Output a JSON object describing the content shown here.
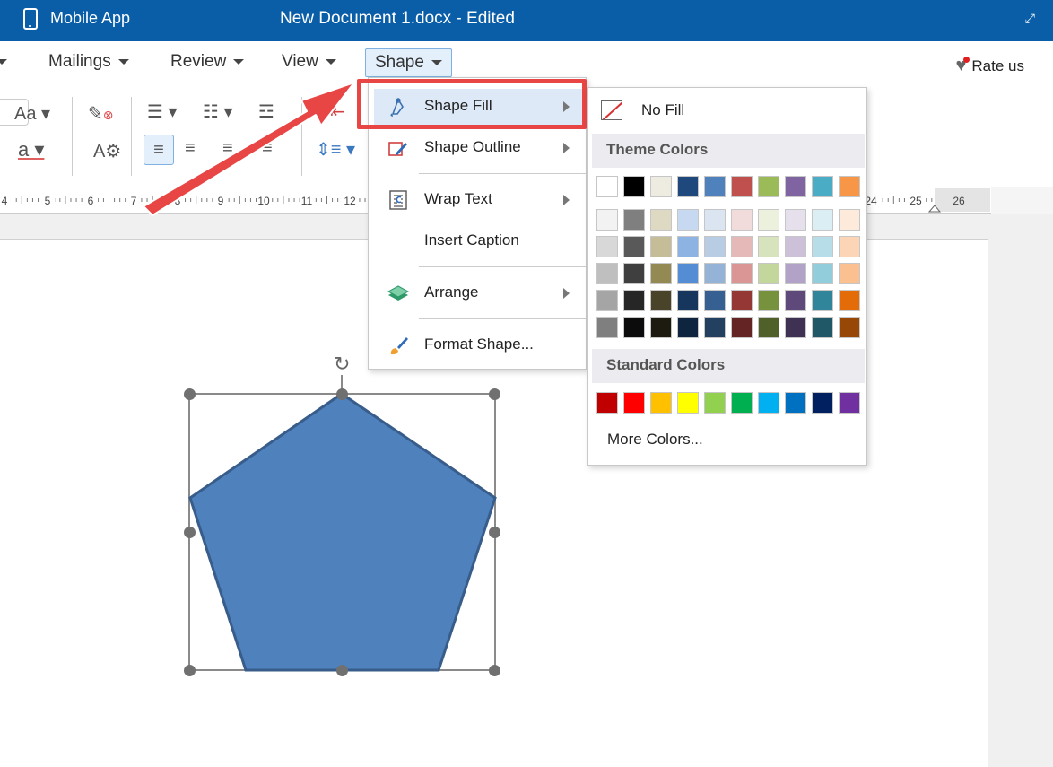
{
  "titlebar": {
    "app_name": "Mobile App",
    "doc_title": "New Document 1.docx - Edited"
  },
  "menubar": {
    "tabs": [
      {
        "label": "Mailings"
      },
      {
        "label": "Review"
      },
      {
        "label": "View"
      },
      {
        "label": "Shape",
        "active": true
      }
    ],
    "rate_label": "Rate us"
  },
  "ruler": {
    "labels": [
      "4",
      "5",
      "6",
      "7",
      "8",
      "9",
      "10",
      "11",
      "12",
      "24",
      "25",
      "26"
    ]
  },
  "shape_menu": {
    "items": [
      {
        "label": "Shape Fill",
        "icon": "paint-bucket-icon",
        "has_submenu": true
      },
      {
        "label": "Shape Outline",
        "icon": "pencil-outline-icon",
        "has_submenu": true
      },
      {
        "label": "Wrap Text",
        "icon": "wrap-text-icon",
        "has_submenu": true
      },
      {
        "label": "Insert Caption",
        "icon": "",
        "has_submenu": false
      },
      {
        "label": "Arrange",
        "icon": "layers-icon",
        "has_submenu": true
      },
      {
        "label": "Format Shape...",
        "icon": "paintbrush-icon",
        "has_submenu": false
      }
    ]
  },
  "color_menu": {
    "no_fill": "No Fill",
    "theme_header": "Theme Colors",
    "standard_header": "Standard Colors",
    "more_colors": "More Colors...",
    "theme_top": [
      "#ffffff",
      "#000000",
      "#eeece1",
      "#1f497d",
      "#4f81bd",
      "#c0504d",
      "#9bbb59",
      "#8064a2",
      "#4bacc6",
      "#f79646"
    ],
    "theme_shades": [
      [
        "#f2f2f2",
        "#7f7f7f",
        "#ddd9c3",
        "#c6d9f0",
        "#dbe5f1",
        "#f2dcdb",
        "#ebf1dd",
        "#e5e0ec",
        "#dbeef3",
        "#fdeada"
      ],
      [
        "#d8d8d8",
        "#595959",
        "#c4bd97",
        "#8db3e2",
        "#b8cce4",
        "#e5b9b7",
        "#d7e3bc",
        "#ccc1d9",
        "#b7dde8",
        "#fbd5b5"
      ],
      [
        "#bfbfbf",
        "#3f3f3f",
        "#938953",
        "#548dd4",
        "#95b3d7",
        "#d99694",
        "#c3d69b",
        "#b2a2c7",
        "#92cddc",
        "#fac08f"
      ],
      [
        "#a5a5a5",
        "#262626",
        "#494429",
        "#17365d",
        "#366092",
        "#953734",
        "#76923c",
        "#5f497a",
        "#31859b",
        "#e36c09"
      ],
      [
        "#7f7f7f",
        "#0c0c0c",
        "#1d1b10",
        "#0f243e",
        "#244061",
        "#632423",
        "#4f6128",
        "#3f3151",
        "#205867",
        "#974806"
      ]
    ],
    "standard": [
      "#c00000",
      "#ff0000",
      "#ffc000",
      "#ffff00",
      "#92d050",
      "#00b050",
      "#00b0f0",
      "#0070c0",
      "#002060",
      "#7030a0"
    ]
  },
  "shape": {
    "fill": "#4f81bd",
    "stroke": "#385d8a"
  }
}
